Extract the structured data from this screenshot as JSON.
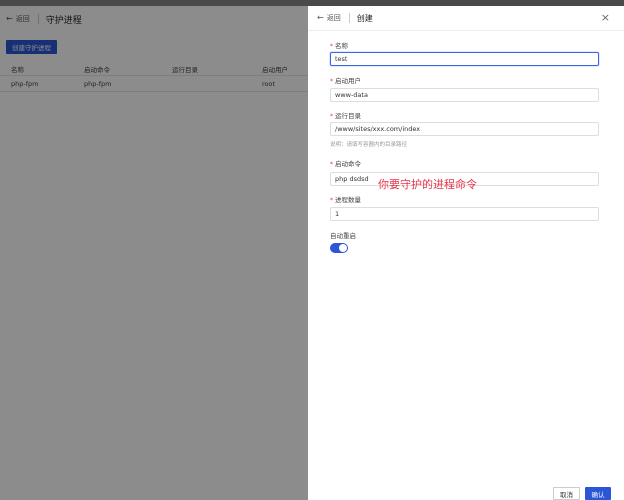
{
  "page": {
    "back_label": "返回",
    "title": "守护进程",
    "create_button": "创建守护进程",
    "table": {
      "columns": [
        "名称",
        "启动命令",
        "运行目录",
        "启动用户"
      ],
      "rows": [
        [
          "php-fpm",
          "php-fpm",
          "",
          "root"
        ]
      ]
    }
  },
  "drawer": {
    "back_label": "返回",
    "title": "创建",
    "fields": {
      "name": {
        "label": "名称",
        "value": "test"
      },
      "user": {
        "label": "启动用户",
        "value": "www-data"
      },
      "dir": {
        "label": "运行目录",
        "value": "/www/sites/xxx.com/index",
        "hint": "说明：请填写容器内的目录路径"
      },
      "command": {
        "label": "启动命令",
        "value": "php dsdsd"
      },
      "count": {
        "label": "进程数量",
        "value": "1"
      },
      "autorestart": {
        "label": "自动重启",
        "enabled": true
      }
    },
    "annotation": "你要守护的进程命令",
    "cancel_label": "取消",
    "confirm_label": "确认"
  },
  "colors": {
    "primary": "#2b56d6",
    "annotation": "#e8344a",
    "overlay": "rgba(0,0,0,0.45)"
  }
}
